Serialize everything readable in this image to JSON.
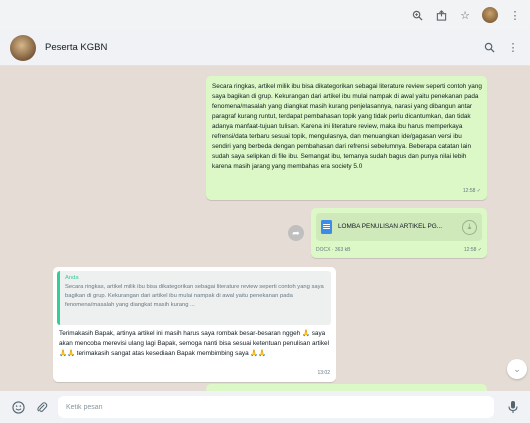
{
  "chat_title": "Peserta KGBN",
  "messages": {
    "summary": {
      "text": "Secara ringkas, artikel milik ibu bisa dikategorikan sebagai literature review seperti contoh yang saya bagikan di grup. Kekurangan dari artikel ibu mulai nampak di awal yaitu penekanan pada fenomena/masalah yang diangkat masih kurang penjelasannya, narasi yang dibangun antar paragraf kurang runtut, terdapat pembahasan topik yang tidak perlu dicantumkan, dan tidak adanya manfaat-tujuan tulisan. Karena ini literature review, maka ibu harus memperkaya refrensi/data terbaru sesuai topik, mengulasnya, dan menuangkan ide/gagasan versi ibu sendiri yang berbeda dengan pembahasan dari refrensi sebelumnya. Beberapa catatan lain sudah saya selipkan di file ibu. Semangat ibu, temanya sudah bagus dan punya nilai lebih karena masih jarang yang membahas era society 5.0",
      "time": "12:58"
    },
    "document": {
      "filename": "LOMBA PENULISAN ARTIKEL PG...",
      "meta": "DOCX · 363 kB",
      "time": "12:58"
    },
    "reply": {
      "quote_name": "Anda",
      "quote_text": "Secara ringkas, artikel milik ibu bisa dikategorikan sebagai literature review seperti contoh yang saya bagikan di grup. Kekurangan dari artikel ibu mulai nampak di awal yaitu penekanan pada fenomena/masalah yang diangkat masih kurang ...",
      "text": "Terimakasih Bapak, artinya artikel ini masih harus saya rombak besar-besaran nggeh 🙏 saya akan mencoba merevisi ulang lagi Bapak, semoga nanti bisa sesuai ketentuan penulisan artikel 🙏🙏 terimakasih sangat  atas kesediaan Bapak membimbing saya 🙏🙏",
      "time": "13:02"
    }
  },
  "composer": {
    "placeholder": "Ketik pesan"
  },
  "icons": {
    "browser": [
      "zoom-icon",
      "share-icon",
      "star-icon",
      "profile-icon",
      "kebab-icon"
    ],
    "header": [
      "search-icon",
      "menu-icon"
    ],
    "footer": [
      "emoji-icon",
      "attach-icon",
      "mic-icon"
    ]
  },
  "colors": {
    "outgoing": "#dcf8c6",
    "incoming": "#ffffff",
    "chat_bg": "#e5ddd5",
    "quote_accent": "#35cd96"
  }
}
